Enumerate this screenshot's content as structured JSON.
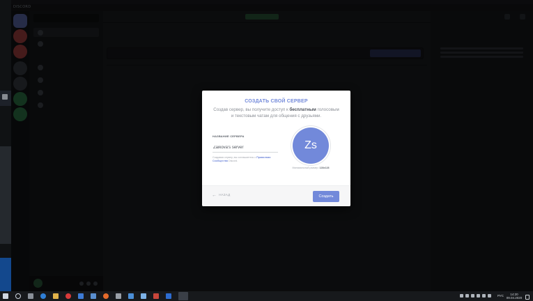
{
  "window": {
    "brand": "DISCORD"
  },
  "modal": {
    "title": "СОЗДАТЬ СВОЙ СЕРВЕР",
    "description_lead": "Создав сервер, вы получите доступ к",
    "description_bold": "бесплатным",
    "description_tail": "голосовым и текстовым чатам для общения с друзьями.",
    "field_label": "НАЗВАНИЕ СЕРВЕРА",
    "server_name_value": "Zaikova's server",
    "note_lead": "Создавая сервер, вы соглашаетесь с",
    "note_link": "Правилами Сообщества",
    "note_tail": "Discord.",
    "avatar_initials": "Zs",
    "size_note_lead": "Минимальный размер:",
    "size_note_value": "128x128",
    "back_label": "НАЗАД",
    "create_label": "Создать"
  },
  "taskbar": {
    "language": "РУС",
    "time": "14:20",
    "date": "09.04.2020"
  },
  "colors": {
    "accent": "#7289da",
    "taskbar": "#17191c"
  }
}
